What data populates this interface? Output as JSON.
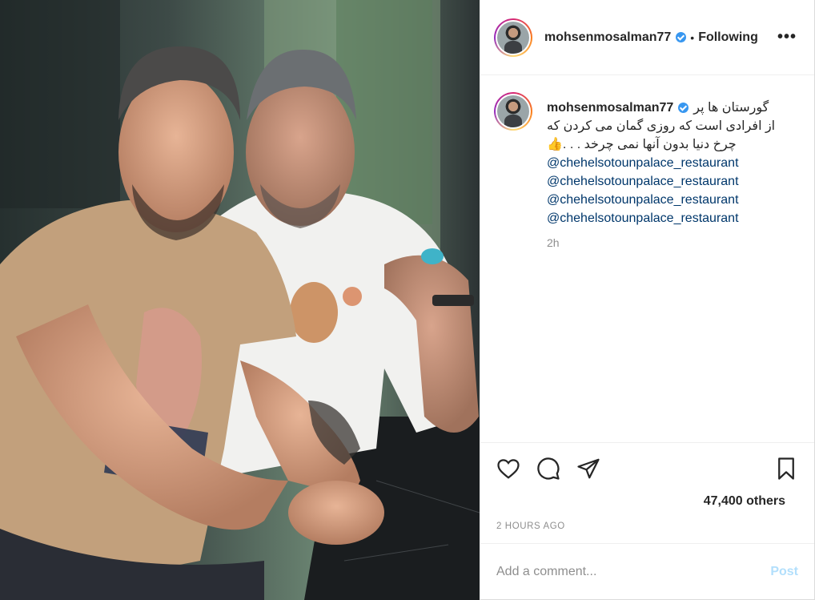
{
  "post": {
    "username": "mohsenmosalman77",
    "follow_separator": "•",
    "follow_status": "Following",
    "more_label": "•••",
    "caption_lines": [
      "گورستان ها پر",
      "از افرادی است که روزی گمان می کردن که",
      "چرخ دنیا بدون آنها نمی چرخد . . ."
    ],
    "caption_emoji": "👍",
    "mentions": [
      "@chehelsotounpalace_restaurant",
      "@chehelsotounpalace_restaurant",
      "@chehelsotounpalace_restaurant",
      "@chehelsotounpalace_restaurant"
    ],
    "caption_time": "2h",
    "likes_text": "47,400 others",
    "timestamp": "2 HOURS AGO",
    "comment": {
      "placeholder": "Add a comment...",
      "post_label": "Post"
    }
  },
  "colors": {
    "link": "#00376b",
    "muted": "#8e8e8e",
    "post_button": "#b2dffc",
    "verified": "#3897f0"
  },
  "icons": [
    "heart-icon",
    "comment-icon",
    "share-icon",
    "save-icon",
    "verified-icon",
    "more-icon"
  ]
}
